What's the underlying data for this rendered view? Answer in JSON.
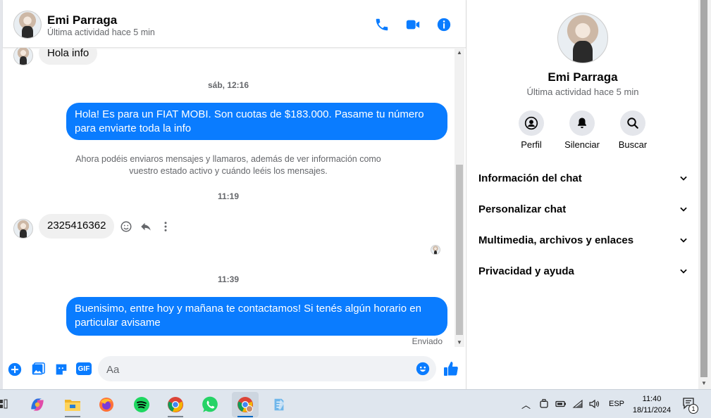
{
  "header": {
    "name": "Emi Parraga",
    "status": "Última actividad hace 5 min"
  },
  "messages": {
    "first_in": "Hola info",
    "ts1": "sáb, 12:16",
    "out1": "Hola! Es para un FIAT MOBI. Son cuotas de $183.000. Pasame tu número para enviarte toda la info",
    "system_note": "Ahora podéis enviaros mensajes y llamaros, además de ver información como vuestro estado activo y cuándo leéis los mensajes.",
    "ts2": "11:19",
    "in2": "2325416362",
    "ts3": "11:39",
    "out2": "Buenisimo, entre hoy y mañana te contactamos! Si tenés algún horario en particular avisame",
    "sent_label": "Enviado"
  },
  "composer": {
    "placeholder": "Aa",
    "gif_label": "GIF"
  },
  "info": {
    "name": "Emi Parraga",
    "status": "Última actividad hace 5 min",
    "actions": [
      "Perfil",
      "Silenciar",
      "Buscar"
    ],
    "sections": [
      "Información del chat",
      "Personalizar chat",
      "Multimedia, archivos y enlaces",
      "Privacidad y ayuda"
    ]
  },
  "taskbar": {
    "language": "ESP",
    "time": "11:40",
    "date": "18/11/2024",
    "notification_count": "1"
  },
  "colors": {
    "accent": "#0a7cff",
    "incoming_bubble": "#f0f0f0",
    "secondary_text": "#65676b"
  }
}
